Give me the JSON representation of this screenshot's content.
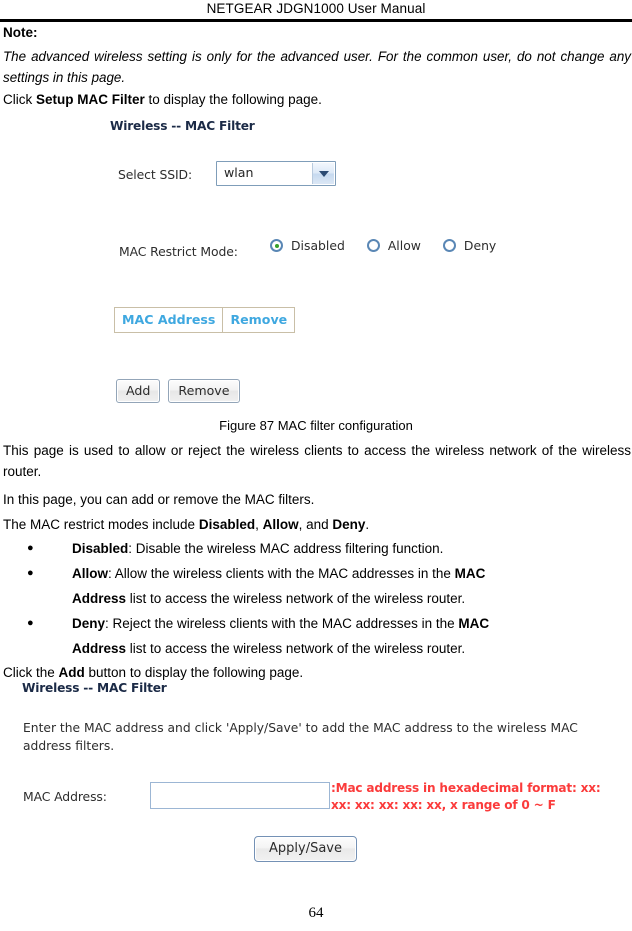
{
  "document": {
    "running_header": "NETGEAR JDGN1000 User Manual",
    "page_number": "64"
  },
  "note": {
    "label": "Note:",
    "italic_text": "The advanced wireless setting is only for the advanced user. For the common user, do not change any settings in this page.",
    "click_setup_prefix": "Click ",
    "click_setup_bold": "Setup MAC Filter",
    "click_setup_suffix": " to display the following page."
  },
  "screenshot_mac_filter": {
    "panel_title": "Wireless -- MAC Filter",
    "ssid_label": "Select SSID:",
    "ssid_value": "wlan",
    "ssid_dropdown_icon": "chevron-down-icon",
    "restrict_mode_label": "MAC Restrict Mode:",
    "restrict_modes": [
      {
        "label": "Disabled",
        "selected": true
      },
      {
        "label": "Allow",
        "selected": false
      },
      {
        "label": "Deny",
        "selected": false
      }
    ],
    "table_headers": [
      "MAC Address",
      "Remove"
    ],
    "buttons": [
      "Add",
      "Remove"
    ]
  },
  "figure_caption": "Figure 87 MAC filter configuration",
  "body": {
    "para1": "This page is used to allow or reject the wireless clients to access the wireless network of the wireless router.",
    "para2": "In this page, you can add or remove the MAC filters.",
    "para3_pre": "The MAC restrict modes include ",
    "para3_b1": "Disabled",
    "para3_mid1": ", ",
    "para3_b2": "Allow",
    "para3_mid2": ", and ",
    "para3_b3": "Deny",
    "para3_end": "."
  },
  "bullets": [
    {
      "term": "Disabled",
      "line1_rest": ": Disable the wireless MAC address filtering function.",
      "line2_bold": "",
      "line2_rest": ""
    },
    {
      "term": "Allow",
      "line1_rest": ": Allow the wireless clients with the MAC addresses in the ",
      "line1_bold_tail": "MAC",
      "line2_bold": "Address",
      "line2_rest": " list to access the wireless network of the wireless router."
    },
    {
      "term": "Deny",
      "line1_rest": ": Reject the wireless clients with the MAC addresses in the ",
      "line1_bold_tail": "MAC",
      "line2_bold": "Address",
      "line2_rest": " list to access the wireless network of the wireless router."
    }
  ],
  "click_add": {
    "prefix": "Click the ",
    "bold": "Add",
    "suffix": " button to display the following page."
  },
  "screenshot_add_mac": {
    "panel_title": "Wireless -- MAC Filter",
    "instruction": "Enter the MAC address and click 'Apply/Save' to add the MAC address to the wireless MAC address filters.",
    "mac_label": "MAC Address:",
    "mac_value": "",
    "mac_placeholder": "",
    "red_hint": ":Mac address in hexadecimal format: xx: xx: xx: xx: xx: xx, x range of 0 ~ F",
    "apply_button": "Apply/Save"
  },
  "colors": {
    "panel_title": "#1b2a46",
    "table_header_text": "#3fa8e0",
    "hint_red": "#fb3b3b",
    "radio_selected_dot": "#37a02a",
    "input_border": "#9cb6d4"
  }
}
